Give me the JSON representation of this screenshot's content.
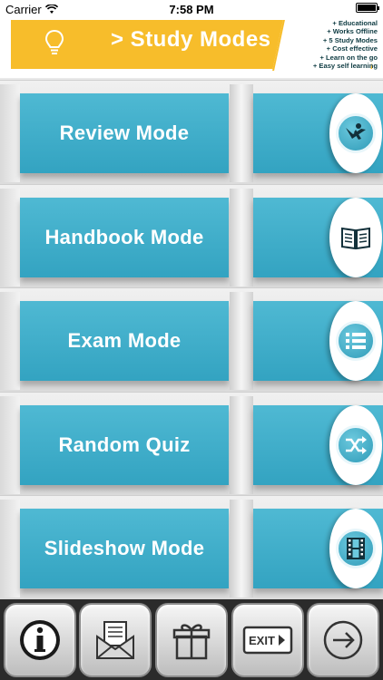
{
  "status_bar": {
    "carrier": "Carrier",
    "time": "7:58 PM"
  },
  "header": {
    "title": "> Study Modes",
    "features": [
      "+ Educational",
      "+ Works Offline",
      "+ 5 Study Modes",
      "+ Cost effective",
      "+ Learn on the go",
      "+ Easy self learning"
    ],
    "colors": {
      "banner": "#f7bd2b",
      "features_text": "#0e3b42"
    }
  },
  "modes": [
    {
      "label": "Review Mode",
      "icon": "reading-person-icon"
    },
    {
      "label": "Handbook Mode",
      "icon": "open-book-icon"
    },
    {
      "label": "Exam Mode",
      "icon": "list-icon"
    },
    {
      "label": "Random Quiz",
      "icon": "shuffle-icon"
    },
    {
      "label": "Slideshow Mode",
      "icon": "film-strip-icon"
    }
  ],
  "toolbar": [
    {
      "icon": "info-icon"
    },
    {
      "icon": "mail-envelope-icon"
    },
    {
      "icon": "gift-icon"
    },
    {
      "icon": "exit-sign-icon",
      "label": "EXIT"
    },
    {
      "icon": "arrow-right-icon"
    }
  ],
  "colors": {
    "mode_button": "#3aabc8",
    "toolbar": "#2b2b2b"
  }
}
